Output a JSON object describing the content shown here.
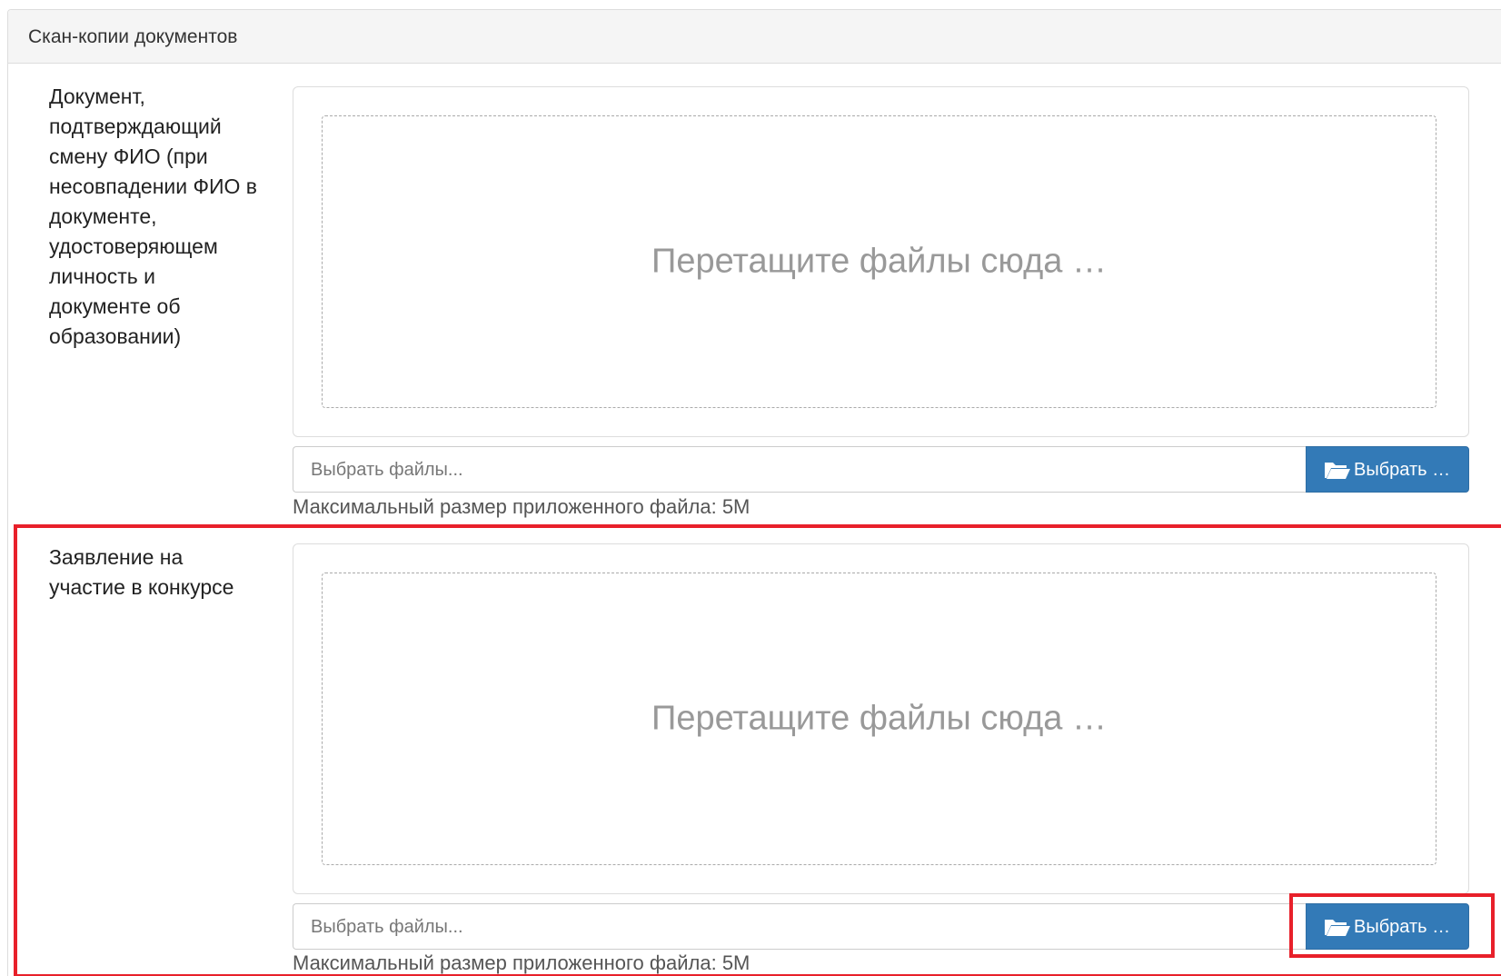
{
  "panel": {
    "title": "Скан-копии документов"
  },
  "rows": [
    {
      "label": "Документ, подтверждающий смену ФИО (при несовпадении ФИО в документе, удостоверяющем личность и документе об образовании)",
      "dropzone_text": "Перетащите файлы сюда …",
      "file_placeholder": "Выбрать файлы...",
      "browse_label": "Выбрать …",
      "hint": "Максимальный размер приложенного файла: 5M"
    },
    {
      "label": "Заявление на участие в конкурсе",
      "dropzone_text": "Перетащите файлы сюда …",
      "file_placeholder": "Выбрать файлы...",
      "browse_label": "Выбрать …",
      "hint": "Максимальный размер приложенного файла: 5M"
    }
  ],
  "icons": {
    "browse_icon": "folder-open-icon"
  },
  "colors": {
    "primary": "#337ab7",
    "highlight": "#e8202a"
  }
}
